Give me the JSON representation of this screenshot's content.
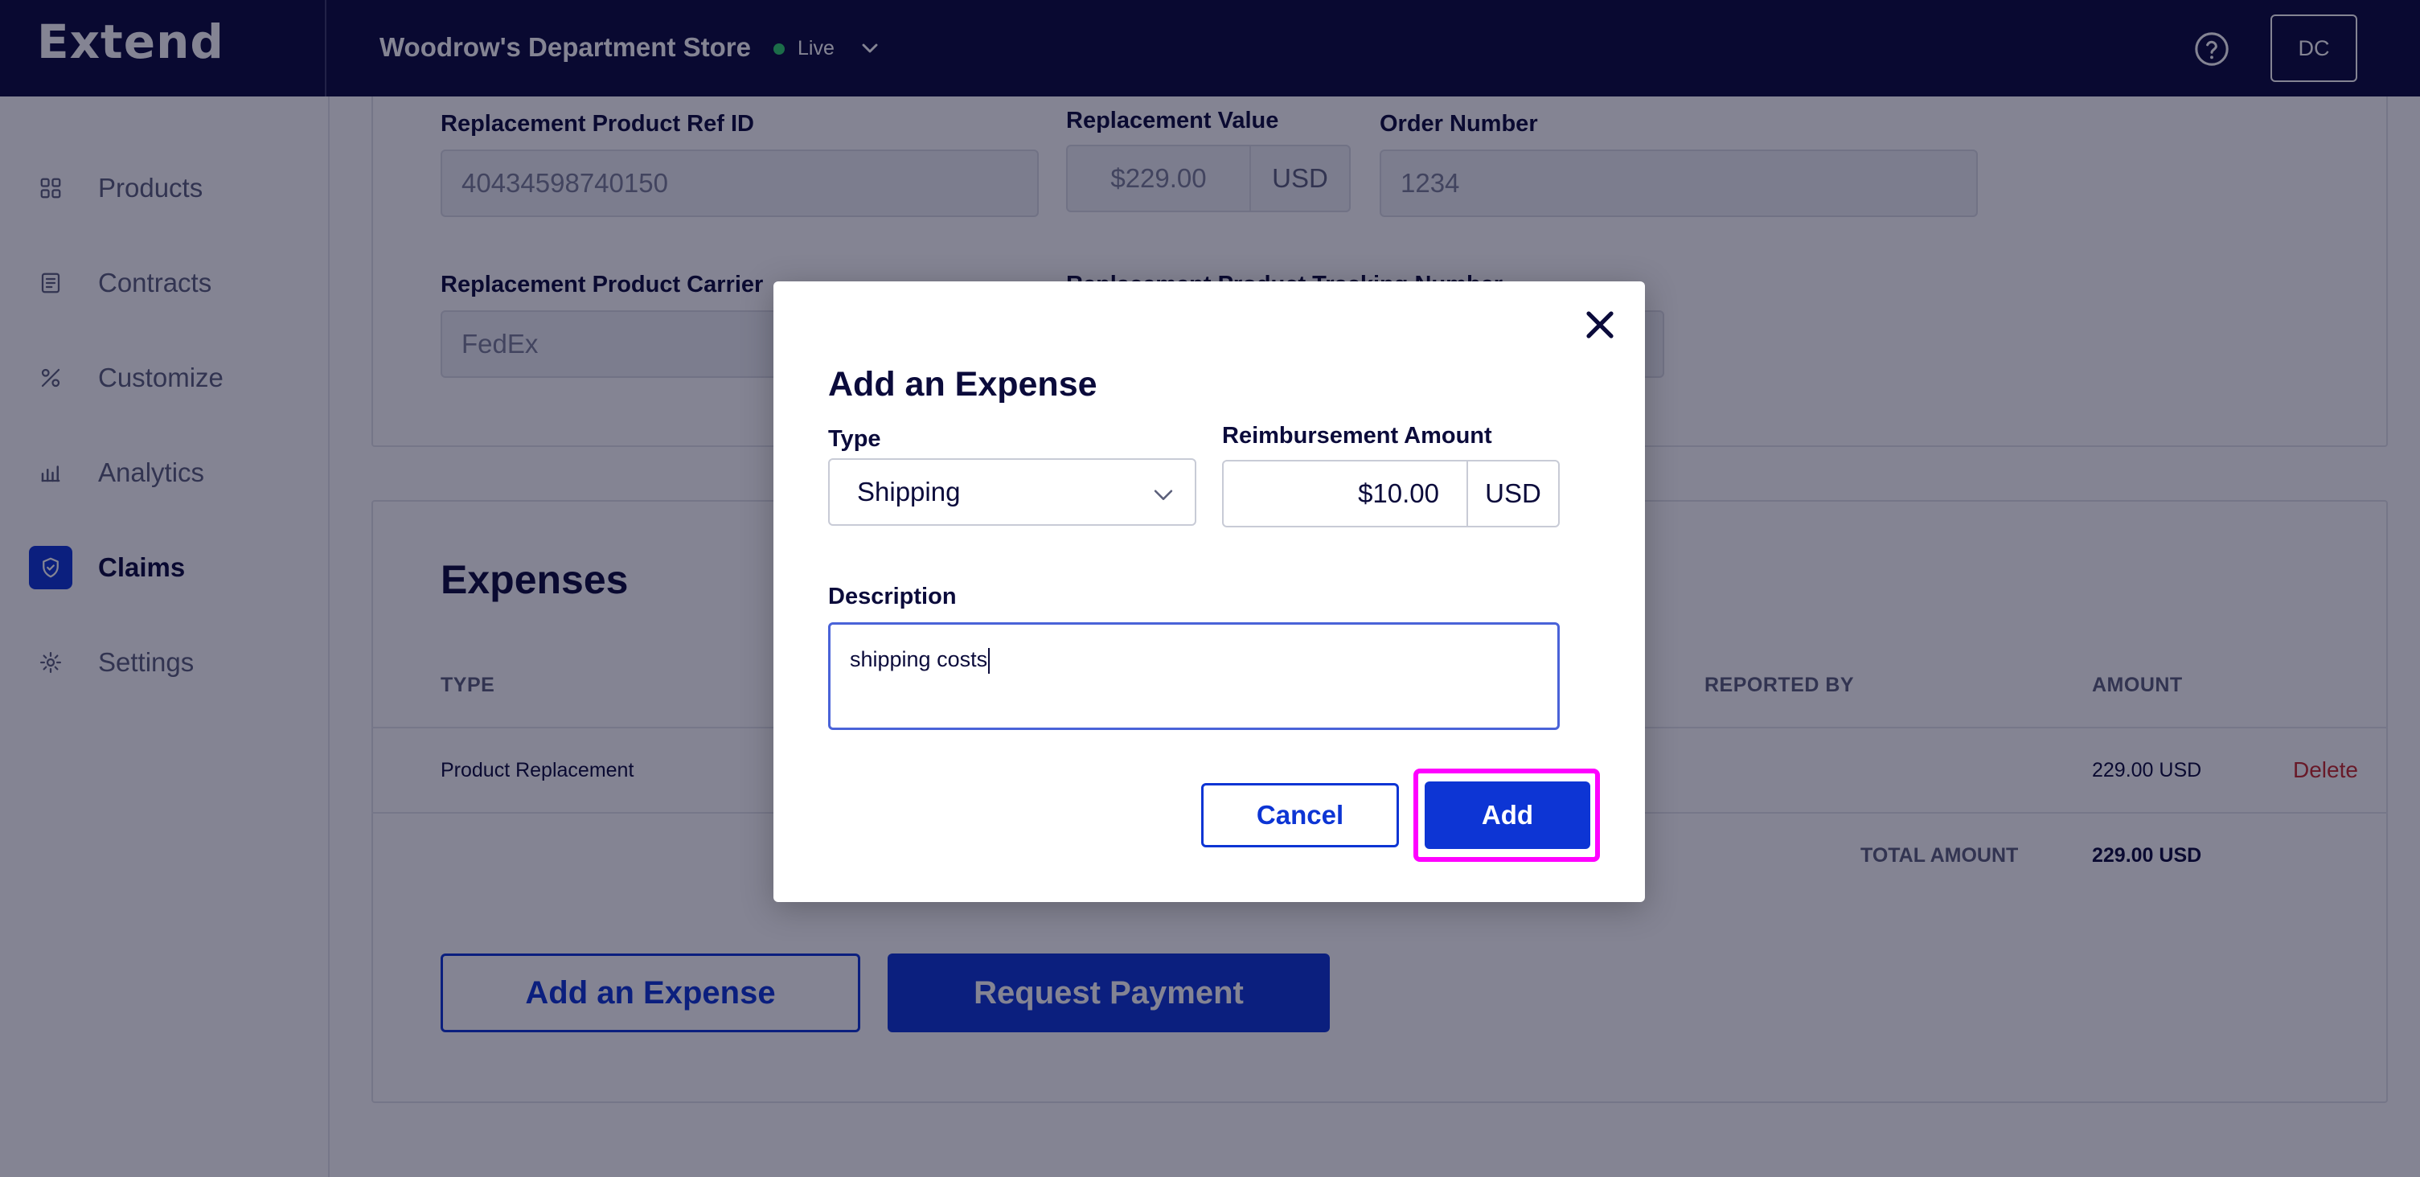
{
  "header": {
    "logo": "Extend",
    "store_name": "Woodrow's Department Store",
    "env_status": "Live",
    "avatar_initials": "DC"
  },
  "sidebar": {
    "items": [
      {
        "label": "Products",
        "icon": "products-icon"
      },
      {
        "label": "Contracts",
        "icon": "contracts-icon"
      },
      {
        "label": "Customize",
        "icon": "customize-icon"
      },
      {
        "label": "Analytics",
        "icon": "analytics-icon"
      },
      {
        "label": "Claims",
        "icon": "claims-shield-icon",
        "active": true
      },
      {
        "label": "Settings",
        "icon": "settings-icon"
      }
    ]
  },
  "replacement": {
    "ref_id_label": "Replacement Product Ref ID",
    "ref_id_value": "40434598740150",
    "value_label": "Replacement Value",
    "value_amount": "$229.00",
    "value_currency": "USD",
    "order_label": "Order Number",
    "order_value": "1234",
    "carrier_label": "Replacement Product Carrier",
    "carrier_value": "FedEx",
    "tracking_label": "Replacement Product Tracking Number"
  },
  "expenses": {
    "title": "Expenses",
    "columns": {
      "type": "TYPE",
      "reported_by": "REPORTED BY",
      "amount": "AMOUNT"
    },
    "rows": [
      {
        "type": "Product Replacement",
        "amount": "229.00 USD",
        "action": "Delete"
      }
    ],
    "total_label": "TOTAL AMOUNT",
    "total_value": "229.00 USD",
    "add_button": "Add an Expense",
    "request_button": "Request Payment"
  },
  "modal": {
    "title": "Add an Expense",
    "type_label": "Type",
    "type_value": "Shipping",
    "amount_label": "Reimbursement Amount",
    "amount_value": "$10.00",
    "amount_currency": "USD",
    "description_label": "Description",
    "description_value": "shipping costs",
    "cancel_button": "Cancel",
    "add_button": "Add"
  },
  "colors": {
    "navy": "#09093a",
    "accent_blue": "#0d35d4",
    "highlight": "#ff00ff",
    "delete_red": "#c62828",
    "live_green": "#2fd16b"
  }
}
